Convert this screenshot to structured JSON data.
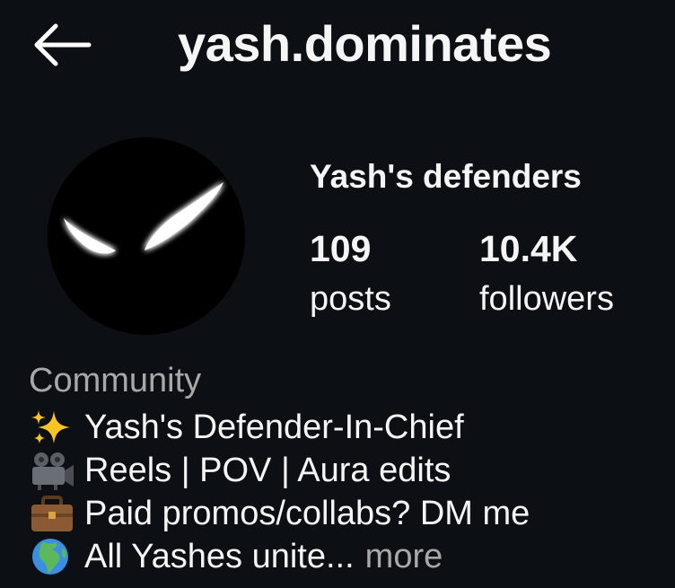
{
  "header": {
    "username": "yash.dominates",
    "back_icon": "arrow-left-icon"
  },
  "profile": {
    "display_name": "Yash's defenders",
    "avatar_icon": "glowing-eyes-avatar",
    "stats": {
      "posts": {
        "count": "109",
        "label": "posts"
      },
      "followers": {
        "count": "10.4K",
        "label": "followers"
      }
    },
    "category": "Community",
    "bio": [
      {
        "icon": "sparkles-icon",
        "emoji": "✨",
        "text": "Yash's Defender-In-Chief"
      },
      {
        "icon": "movie-camera-icon",
        "emoji": "🎥",
        "text": "Reels | POV | Aura edits"
      },
      {
        "icon": "briefcase-icon",
        "emoji": "💼",
        "text": "Paid promos/collabs? DM me"
      },
      {
        "icon": "globe-africa-europe-icon",
        "emoji": "🌍",
        "text": "All Yashes unite..."
      }
    ],
    "more_label": "more"
  }
}
